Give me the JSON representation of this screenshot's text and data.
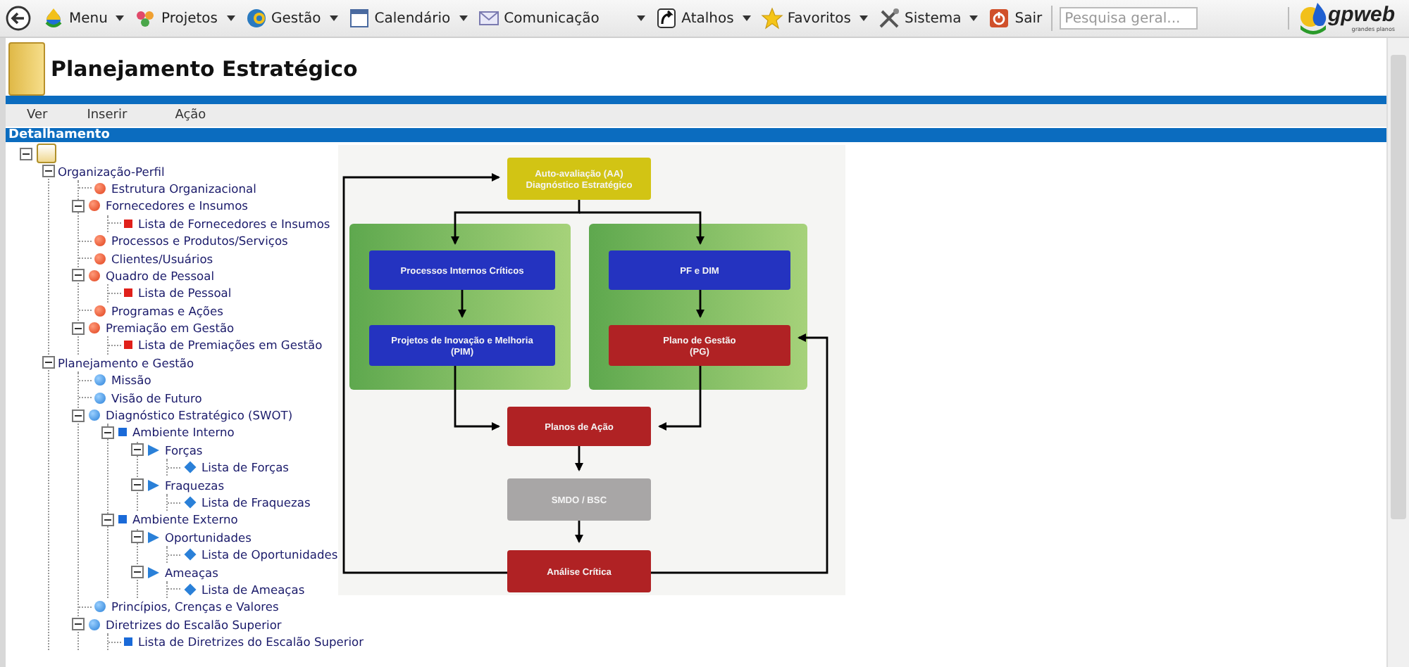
{
  "toolbar": {
    "items": [
      {
        "label": "Menu",
        "kind": "drop",
        "dropdown": true
      },
      {
        "label": "Projetos",
        "kind": "flower",
        "dropdown": true
      },
      {
        "label": "Gestão",
        "kind": "globe",
        "dropdown": true
      },
      {
        "label": "Calendário",
        "kind": "calendar",
        "dropdown": true
      },
      {
        "label": "Comunicação",
        "kind": "mail",
        "dropdown": true
      },
      {
        "label": "Atalhos",
        "kind": "shortcut",
        "dropdown": true
      },
      {
        "label": "Favoritos",
        "kind": "star",
        "dropdown": true
      },
      {
        "label": "Sistema",
        "kind": "tools",
        "dropdown": true
      },
      {
        "label": "Sair",
        "kind": "power",
        "dropdown": false
      }
    ],
    "search": {
      "placeholder": "Pesquisa geral..."
    }
  },
  "logo": {
    "name": "gpweb",
    "tagline": "grandes planos"
  },
  "page": {
    "title": "Planejamento Estratégico"
  },
  "menu": [
    "Ver",
    "Inserir",
    "Ação"
  ],
  "section": {
    "title": "Detalhamento"
  },
  "tree": {
    "kind": "root",
    "expanded": true,
    "children": [
      {
        "label": "Organização-Perfil",
        "expanded": true,
        "children": [
          {
            "label": "Estrutura Organizacional",
            "kind": "red-dot"
          },
          {
            "label": "Fornecedores e Insumos",
            "kind": "red-dot",
            "expanded": true,
            "children": [
              {
                "label": "Lista de Fornecedores e Insumos",
                "kind": "red-square"
              }
            ]
          },
          {
            "label": "Processos e Produtos/Serviços",
            "kind": "red-dot"
          },
          {
            "label": "Clientes/Usuários",
            "kind": "red-dot"
          },
          {
            "label": "Quadro de Pessoal",
            "kind": "red-dot",
            "expanded": true,
            "children": [
              {
                "label": "Lista de Pessoal",
                "kind": "red-square"
              }
            ]
          },
          {
            "label": "Programas e Ações",
            "kind": "red-dot"
          },
          {
            "label": "Premiação em Gestão",
            "kind": "red-dot",
            "expanded": true,
            "children": [
              {
                "label": "Lista de Premiações em Gestão",
                "kind": "red-square"
              }
            ]
          }
        ]
      },
      {
        "label": "Planejamento e Gestão",
        "expanded": true,
        "children": [
          {
            "label": "Missão",
            "kind": "blue-dot"
          },
          {
            "label": "Visão de Futuro",
            "kind": "blue-dot"
          },
          {
            "label": "Diagnóstico Estratégico (SWOT)",
            "kind": "blue-dot",
            "expanded": true,
            "children": [
              {
                "label": "Ambiente Interno",
                "kind": "blue-square",
                "expanded": true,
                "children": [
                  {
                    "label": "Forças",
                    "kind": "blue-arrow",
                    "expanded": true,
                    "children": [
                      {
                        "label": "Lista de Forças",
                        "kind": "blue-diamond"
                      }
                    ]
                  },
                  {
                    "label": "Fraquezas",
                    "kind": "blue-arrow",
                    "expanded": true,
                    "children": [
                      {
                        "label": "Lista de Fraquezas",
                        "kind": "blue-diamond"
                      }
                    ]
                  }
                ]
              },
              {
                "label": "Ambiente Externo",
                "kind": "blue-square",
                "expanded": true,
                "children": [
                  {
                    "label": "Oportunidades",
                    "kind": "blue-arrow",
                    "expanded": true,
                    "children": [
                      {
                        "label": "Lista de Oportunidades",
                        "kind": "blue-diamond"
                      }
                    ]
                  },
                  {
                    "label": "Ameaças",
                    "kind": "blue-arrow",
                    "expanded": true,
                    "children": [
                      {
                        "label": "Lista de Ameaças",
                        "kind": "blue-diamond"
                      }
                    ]
                  }
                ]
              }
            ]
          },
          {
            "label": "Princípios, Crenças e Valores",
            "kind": "blue-dot"
          },
          {
            "label": "Diretrizes do Escalão Superior",
            "kind": "blue-dot",
            "expanded": true,
            "children": [
              {
                "label": "Lista de Diretrizes do Escalão Superior",
                "kind": "blue-square"
              }
            ]
          }
        ]
      }
    ]
  },
  "diagram": {
    "nodes": [
      {
        "lines": [
          "Auto-avaliação (AA)",
          "Diagnóstico Estratégico"
        ],
        "color": "#d2c414"
      },
      {
        "lines": [
          "Processos Internos Críticos"
        ],
        "color": "#2433c0"
      },
      {
        "lines": [
          "Projetos de Inovação e Melhoria",
          "(PIM)"
        ],
        "color": "#2433c0"
      },
      {
        "lines": [
          "PF e DIM"
        ],
        "color": "#2433c0"
      },
      {
        "lines": [
          "Plano de Gestão",
          "(PG)"
        ],
        "color": "#b02224"
      },
      {
        "lines": [
          "Planos de Ação"
        ],
        "color": "#b02224"
      },
      {
        "lines": [
          "SMDO / BSC"
        ],
        "color": "#a8a6a6"
      },
      {
        "lines": [
          "Análise Crítica"
        ],
        "color": "#b02224"
      }
    ]
  }
}
